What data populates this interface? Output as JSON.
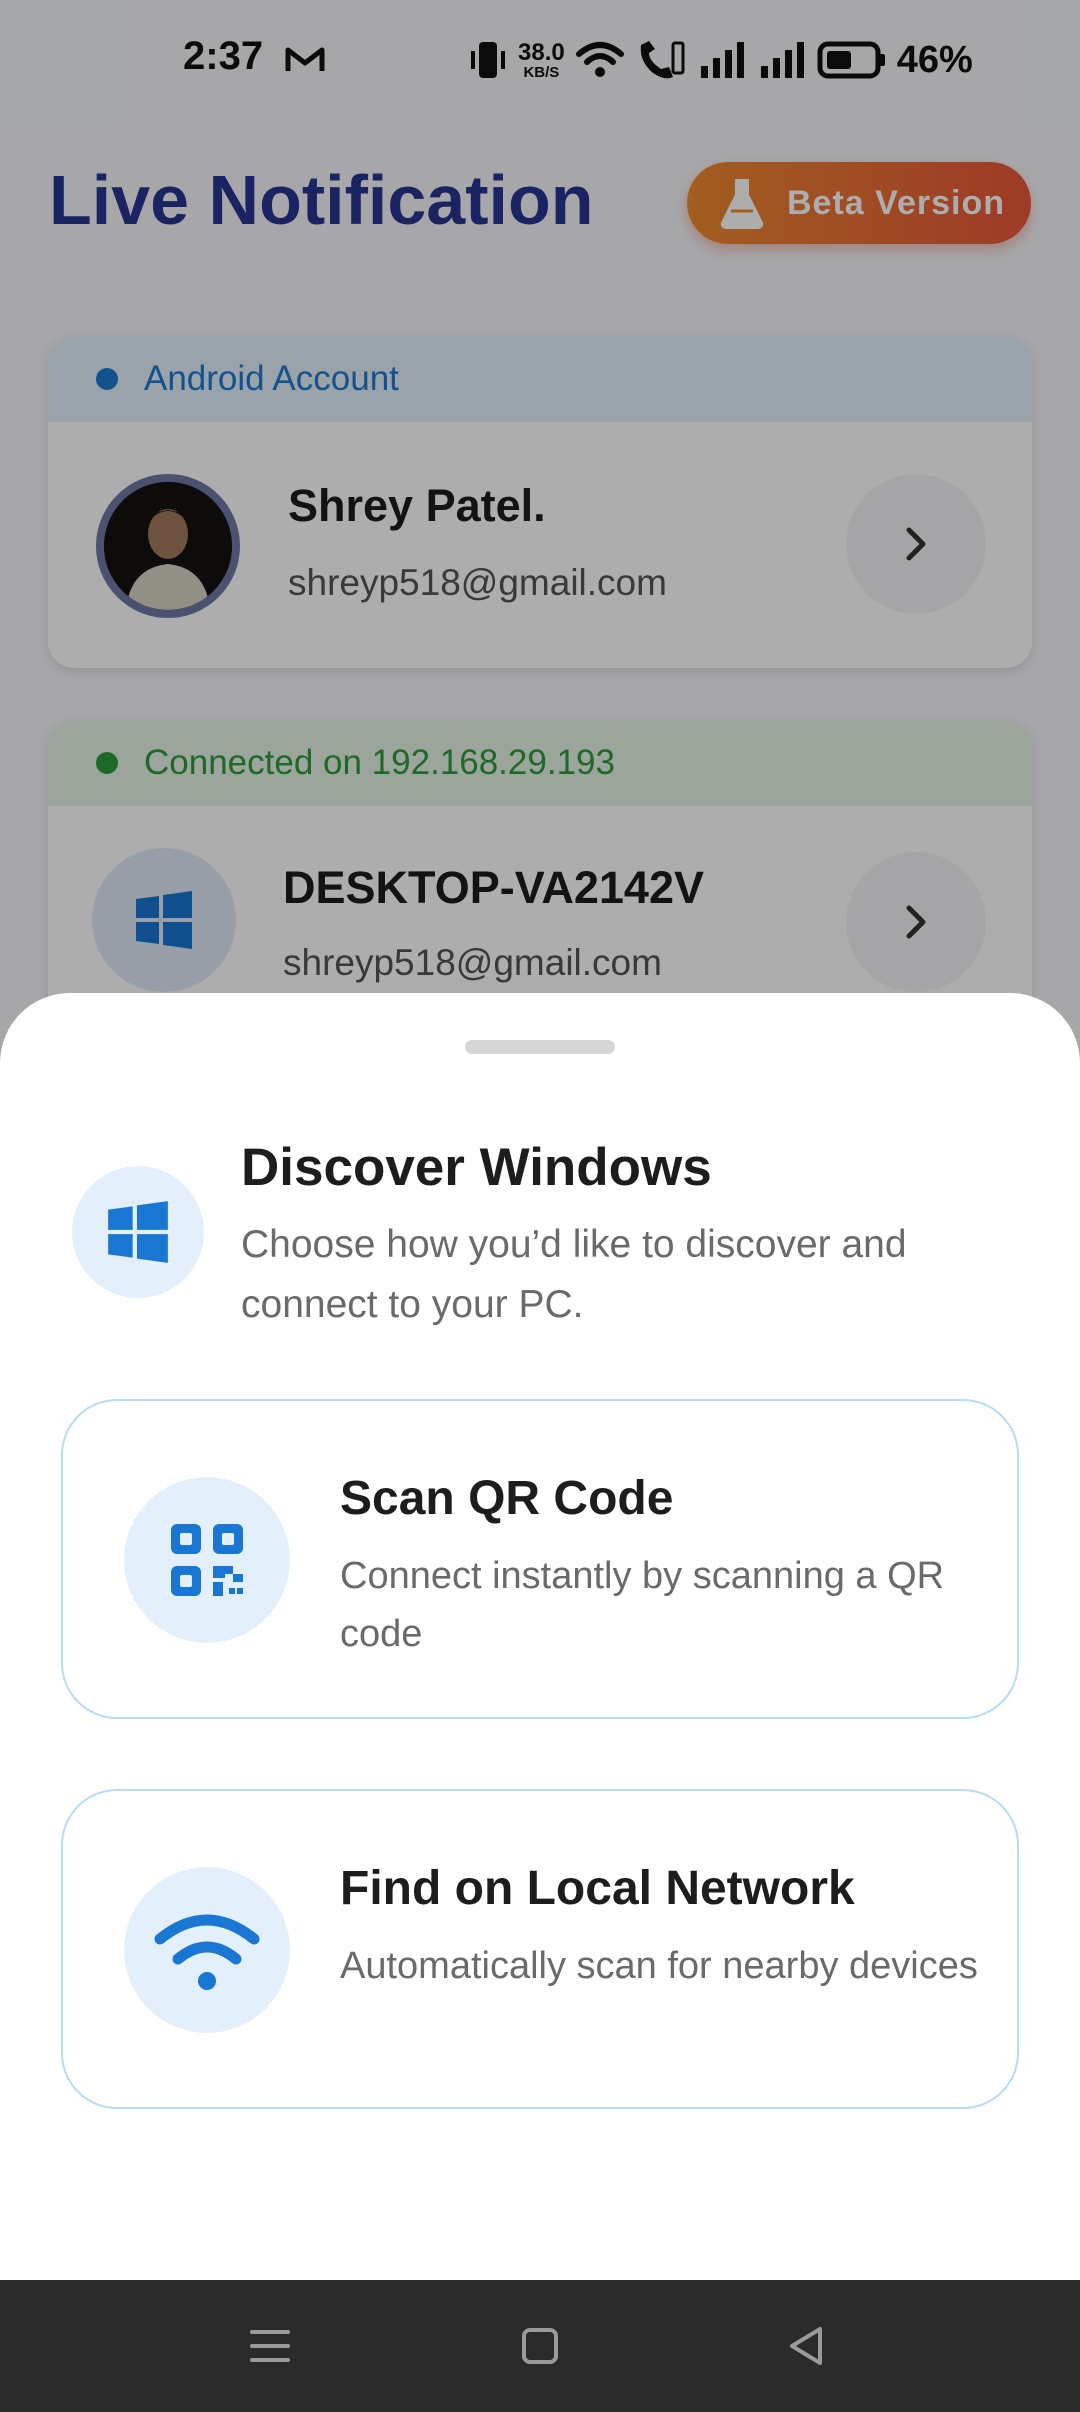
{
  "status_bar": {
    "time": "2:37",
    "net_speed_value": "38.0",
    "net_speed_unit": "KB/S",
    "battery_percent": "46%",
    "icons": [
      "gmail-icon",
      "vibrate-icon",
      "wifi-icon",
      "wifi-calling-icon",
      "signal-icon",
      "signal-icon",
      "battery-icon"
    ]
  },
  "header": {
    "title": "Live Notification",
    "beta_label": "Beta Version"
  },
  "account_card": {
    "status": "Android Account",
    "name": "Shrey Patel.",
    "email": "shreyp518@gmail.com",
    "status_color": "#1e7ad0"
  },
  "device_card": {
    "status": "Connected on 192.168.29.193",
    "name": "DESKTOP-VA2142V",
    "email": "shreyp518@gmail.com",
    "status_color": "#2e9b3c"
  },
  "sheet": {
    "title": "Discover Windows",
    "subtitle": "Choose how you’d like to discover and connect to your PC.",
    "options": [
      {
        "title": "Scan QR Code",
        "description": "Connect instantly by scanning a QR code",
        "icon": "qr-code-icon"
      },
      {
        "title": "Find on Local Network",
        "description": "Automatically scan for nearby devices",
        "icon": "wifi-icon"
      }
    ]
  },
  "colors": {
    "title": "#283593",
    "accent_blue": "#1976d2",
    "beta_gradient_start": "#f08a30",
    "beta_gradient_end": "#e8563a"
  },
  "navigation": [
    "menu-icon",
    "home-icon",
    "back-icon"
  ]
}
